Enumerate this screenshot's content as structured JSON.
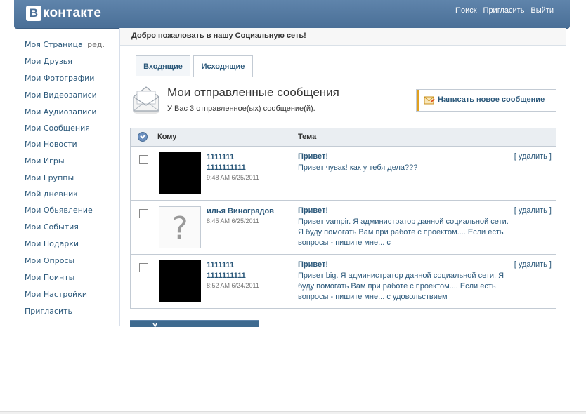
{
  "header": {
    "logo_letter": "В",
    "logo_text": "контакте",
    "nav": [
      "Поиск",
      "Пригласить",
      "Выйти"
    ]
  },
  "sidebar": {
    "edit_label": "ред.",
    "items": [
      "Моя Страница",
      "Мои Друзья",
      "Мои Фотографии",
      "Мои Видеозаписи",
      "Мои Аудиозаписи",
      "Мои Сообщения",
      "Мои Новости",
      "Мои Игры",
      "Мои Группы",
      "Мой дневник",
      "Мои Обьявление",
      "Мои События",
      "Мои Подарки",
      "Мои Опросы",
      "Мои Поинты",
      "Мои Настройки",
      "Пригласить"
    ]
  },
  "welcome": "Добро пожаловать в нашу Социальную сеть!",
  "tabs": {
    "inbox": "Входящие",
    "outbox": "Исходящие"
  },
  "section": {
    "title": "Мои отправленные сообщения",
    "subtitle": "У Вас 3 отправленное(ых) сообщение(й)."
  },
  "compose_label": "Написать новое сообщение",
  "table": {
    "col_to": "Кому",
    "col_subject": "Тема",
    "rows": [
      {
        "sender_line1": "1111111",
        "sender_line2": "1111111111",
        "date": "9:48 AM 6/25/2011",
        "subject": "Привет!",
        "preview": "Привет чувак! как у тебя дела???",
        "delete": "[ удалить ]"
      },
      {
        "sender_line1": "илья Виноградов",
        "sender_line2": "",
        "date": "8:45 AM 6/25/2011",
        "subject": "Привет!",
        "preview": "Привет vampir. Я администратор данной социальной сети. Я буду помогать Вам при работе с проектом.... Если есть вопросы - пишите мне... с",
        "delete": "[ удалить ]"
      },
      {
        "sender_line1": "1111111",
        "sender_line2": "1111111111",
        "date": "8:52 AM 6/24/2011",
        "subject": "Привет!",
        "preview": "Привет big. Я администратор данной социальной сети. Я буду помогать Вам при работе с проектом.... Если есть вопросы - пишите мне... с удовольствием",
        "delete": "[ удалить ]"
      }
    ]
  },
  "bottom_button": "У"
}
